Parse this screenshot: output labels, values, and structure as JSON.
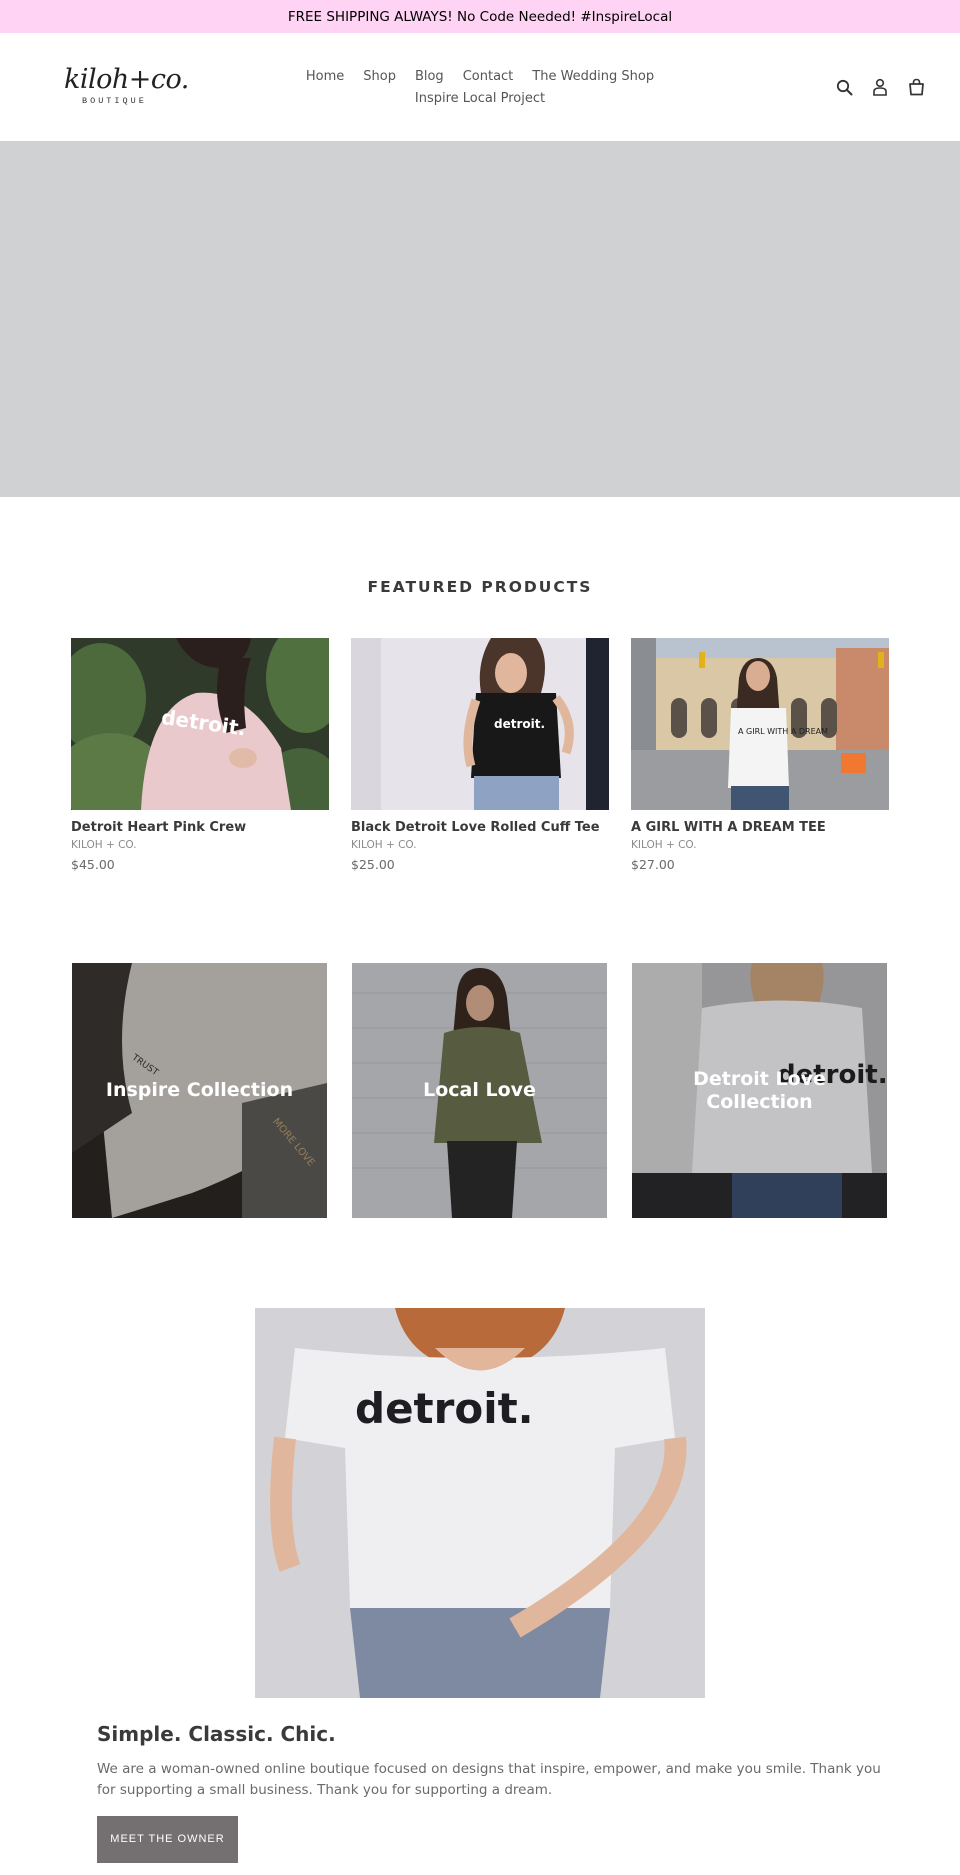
{
  "announcement": {
    "text": "FREE SHIPPING ALWAYS! No Code Needed! #InspireLocal"
  },
  "header": {
    "logo_script": "kiloh+co.",
    "logo_sub": "BOUTIQUE",
    "nav": [
      "Home",
      "Shop",
      "Blog",
      "Contact",
      "The Wedding Shop",
      "Inspire Local Project"
    ],
    "icons": [
      "search-icon",
      "account-icon",
      "cart-icon"
    ]
  },
  "featured": {
    "title": "FEATURED PRODUCTS",
    "products": [
      {
        "name": "Detroit Heart Pink Crew",
        "vendor": "KILOH + CO.",
        "price": "$45.00",
        "image_text": "detroit."
      },
      {
        "name": "Black Detroit Love Rolled Cuff Tee",
        "vendor": "KILOH + CO.",
        "price": "$25.00",
        "image_text": "detroit."
      },
      {
        "name": "A GIRL WITH A DREAM TEE",
        "vendor": "KILOH + CO.",
        "price": "$27.00",
        "image_text": "A GIRL WITH A DREAM"
      }
    ]
  },
  "collections": [
    {
      "title": "Inspire Collection"
    },
    {
      "title": "Local Love"
    },
    {
      "title": "Detroit Love Collection"
    }
  ],
  "feature_image": {
    "shirt_text": "detroit."
  },
  "about": {
    "title": "Simple. Classic. Chic.",
    "text": "We are a woman-owned online boutique focused on designs that inspire, empower, and make you smile. Thank you for supporting a small business. Thank you for supporting a dream.",
    "button": "MEET THE OWNER"
  },
  "colors": {
    "announcement_bg": "#ffd3f3",
    "hero_bg": "#d0d1d3",
    "button_bg": "#746f71"
  }
}
